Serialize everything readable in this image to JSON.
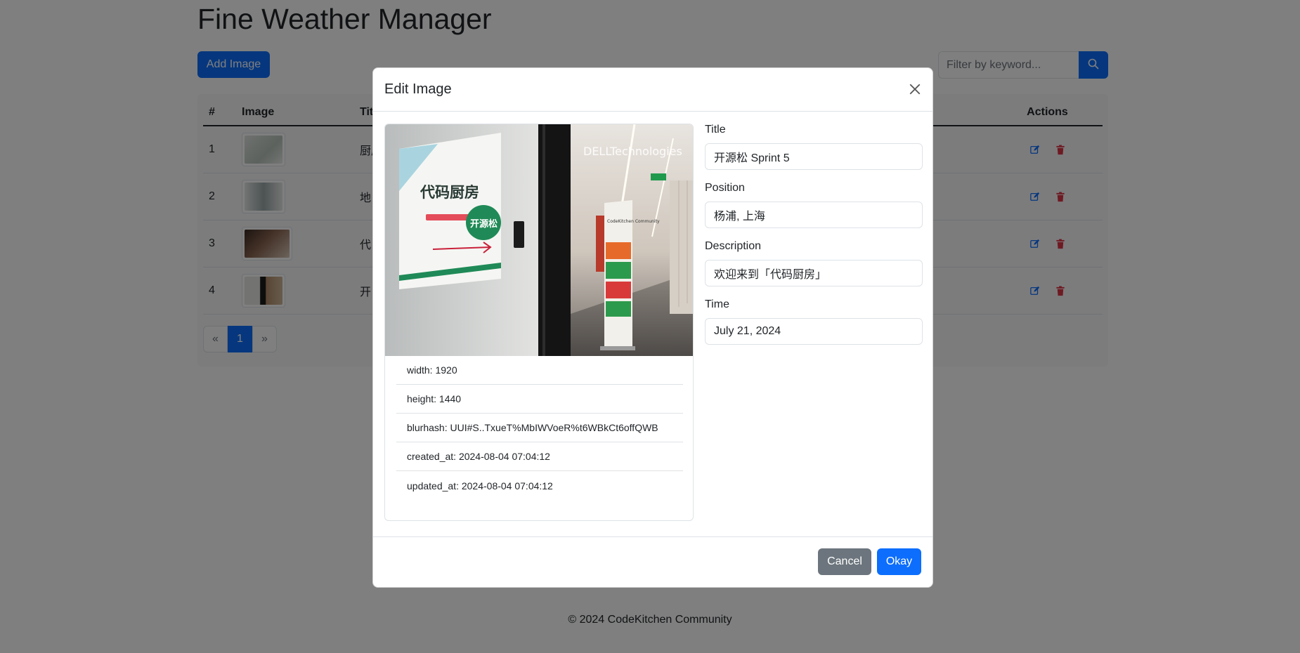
{
  "app": {
    "title": "Fine Weather Manager",
    "add_button": "Add Image",
    "search_placeholder": "Filter by keyword...",
    "footer": "© 2024 CodeKitchen Community"
  },
  "table": {
    "headers": {
      "num": "#",
      "image": "Image",
      "title": "Title",
      "actions": "Actions"
    },
    "rows": [
      {
        "num": "1",
        "title": "厨房"
      },
      {
        "num": "2",
        "title": "地"
      },
      {
        "num": "3",
        "title": "代"
      },
      {
        "num": "4",
        "title": "开"
      }
    ]
  },
  "pagination": {
    "prev": "«",
    "current": "1",
    "next": "»"
  },
  "modal": {
    "title": "Edit Image",
    "meta": {
      "width": "width: 1920",
      "height": "height: 1440",
      "blurhash": "blurhash: UUI#S..TxueT%MbIWVoeR%t6WBkCt6offQWB",
      "created_at": "created_at: 2024-08-04 07:04:12",
      "updated_at": "updated_at: 2024-08-04 07:04:12"
    },
    "photo_text": {
      "sign": "代码厨房",
      "badge": "开源松",
      "brand": "DELLTechnologies",
      "banner": "CodeKitchen Community"
    },
    "form": {
      "title_label": "Title",
      "title_value": "开源松 Sprint 5",
      "position_label": "Position",
      "position_value": "杨浦, 上海",
      "description_label": "Description",
      "description_value": "欢迎来到「代码厨房」",
      "time_label": "Time",
      "time_value": "July 21, 2024"
    },
    "cancel": "Cancel",
    "okay": "Okay"
  },
  "colors": {
    "primary": "#0d6efd",
    "secondary": "#6c757d",
    "danger": "#dc3545"
  }
}
